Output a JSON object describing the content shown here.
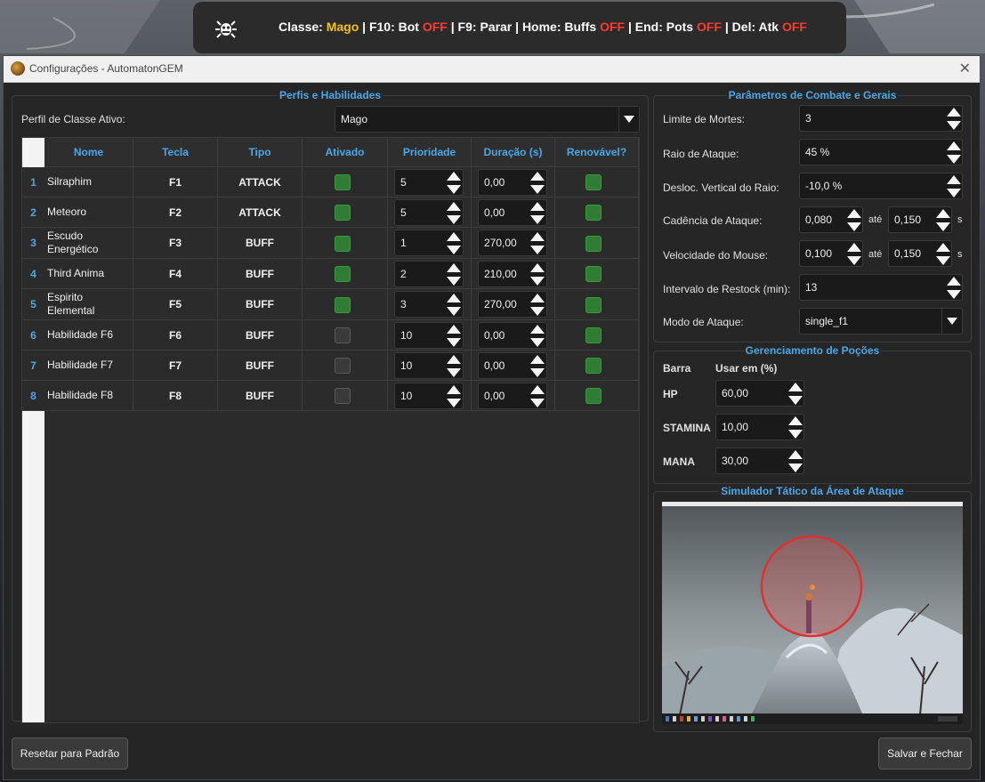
{
  "overlay": {
    "segments": [
      {
        "text": "Classe: ",
        "style": "normal"
      },
      {
        "text": "Mago",
        "style": "hl"
      },
      {
        "text": " | F10: Bot ",
        "style": "normal"
      },
      {
        "text": "OFF",
        "style": "off"
      },
      {
        "text": " | F9: Parar | Home: Buffs ",
        "style": "normal"
      },
      {
        "text": "OFF",
        "style": "off"
      },
      {
        "text": " | End: Pots ",
        "style": "normal"
      },
      {
        "text": "OFF",
        "style": "off"
      },
      {
        "text": " | Del: Atk ",
        "style": "normal"
      },
      {
        "text": "OFF",
        "style": "off"
      }
    ]
  },
  "window": {
    "title": "Configurações - AutomatonGEM",
    "close_glyph": "✕"
  },
  "profiles": {
    "section_title": "Perfis e Habilidades",
    "active_label": "Perfil de Classe Ativo:",
    "active_value": "Mago",
    "columns": [
      "Nome",
      "Tecla",
      "Tipo",
      "Ativado",
      "Prioridade",
      "Duração (s)",
      "Renovável?"
    ],
    "rows": [
      {
        "num": "1",
        "name": "Silraphim",
        "key": "F1",
        "type": "ATTACK",
        "enabled": true,
        "priority": "5",
        "duration": "0,00",
        "renewable": true
      },
      {
        "num": "2",
        "name": "Meteoro",
        "key": "F2",
        "type": "ATTACK",
        "enabled": true,
        "priority": "5",
        "duration": "0,00",
        "renewable": true
      },
      {
        "num": "3",
        "name": "Escudo Energético",
        "key": "F3",
        "type": "BUFF",
        "enabled": true,
        "priority": "1",
        "duration": "270,00",
        "renewable": true
      },
      {
        "num": "4",
        "name": "Third Anima",
        "key": "F4",
        "type": "BUFF",
        "enabled": true,
        "priority": "2",
        "duration": "210,00",
        "renewable": true
      },
      {
        "num": "5",
        "name": "Espirito Elemental",
        "key": "F5",
        "type": "BUFF",
        "enabled": true,
        "priority": "3",
        "duration": "270,00",
        "renewable": true
      },
      {
        "num": "6",
        "name": "Habilidade F6",
        "key": "F6",
        "type": "BUFF",
        "enabled": false,
        "priority": "10",
        "duration": "0,00",
        "renewable": true
      },
      {
        "num": "7",
        "name": "Habilidade F7",
        "key": "F7",
        "type": "BUFF",
        "enabled": false,
        "priority": "10",
        "duration": "0,00",
        "renewable": true
      },
      {
        "num": "8",
        "name": "Habilidade F8",
        "key": "F8",
        "type": "BUFF",
        "enabled": false,
        "priority": "10",
        "duration": "0,00",
        "renewable": true
      }
    ]
  },
  "combat": {
    "section_title": "Parâmetros de Combate e Gerais",
    "death_limit_label": "Limite de Mortes:",
    "death_limit_value": "3",
    "attack_radius_label": "Raio de Ataque:",
    "attack_radius_value": "45 %",
    "radius_offset_label": "Desloc. Vertical do Raio:",
    "radius_offset_value": "-10,0 %",
    "cadence_label": "Cadência de Ataque:",
    "cadence_min": "0,080",
    "cadence_to": "até",
    "cadence_max": "0,150",
    "cadence_unit": "s",
    "mouse_speed_label": "Velocidade do Mouse:",
    "mouse_min": "0,100",
    "mouse_to": "até",
    "mouse_max": "0,150",
    "mouse_unit": "s",
    "restock_label": "Intervalo de Restock (min):",
    "restock_value": "13",
    "attack_mode_label": "Modo de Ataque:",
    "attack_mode_value": "single_f1"
  },
  "potions": {
    "section_title": "Gerenciamento de Poções",
    "col_bar": "Barra",
    "col_use": "Usar em (%)",
    "rows": [
      {
        "name": "HP",
        "value": "60,00"
      },
      {
        "name": "STAMINA",
        "value": "10,00"
      },
      {
        "name": "MANA",
        "value": "30,00"
      }
    ]
  },
  "simulator": {
    "section_title": "Simulador Tático da Área de Ataque"
  },
  "footer": {
    "reset_label": "Resetar para Padrão",
    "save_label": "Salvar e Fechar"
  },
  "colors": {
    "accent": "#4aa8e8",
    "enabled_check": "#2e7d32",
    "off_text": "#ff3b2f",
    "class_highlight": "#f4c20d",
    "radius_circle": "#e03030"
  }
}
